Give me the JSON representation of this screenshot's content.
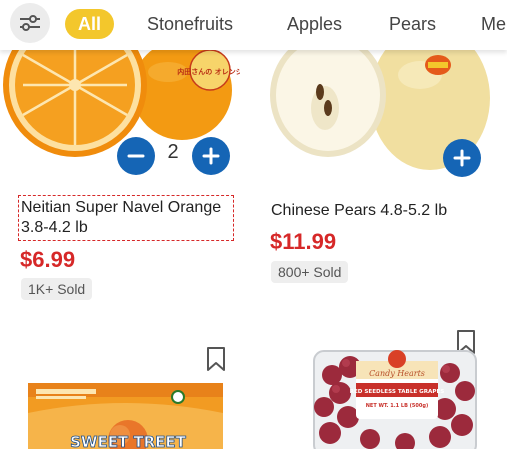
{
  "categories": {
    "items": [
      {
        "label": "All",
        "active": true
      },
      {
        "label": "Stonefruits",
        "active": false
      },
      {
        "label": "Apples",
        "active": false
      },
      {
        "label": "Pears",
        "active": false
      },
      {
        "label": "Me",
        "active": false
      }
    ]
  },
  "products": [
    {
      "name": "Neitian Super Navel Orange 3.8-4.2 lb",
      "price": "$6.99",
      "sold": "1K+ Sold",
      "quantity": "2",
      "image_label": "内田さんの オレンジ"
    },
    {
      "name": "Chinese Pears 4.8-5.2 lb",
      "price": "$11.99",
      "sold": "800+ Sold"
    },
    {
      "image_label": "SWEET TREET"
    },
    {
      "image_label_top": "Candy Hearts",
      "image_label_mid": "RED SEEDLESS TABLE GRAPES",
      "image_label_net": "NET WT. 1.1 LB (500g)"
    }
  ],
  "colors": {
    "accent_yellow": "#f3c72c",
    "action_blue": "#1565b5",
    "price_red": "#d62828",
    "badge_bg": "#eeeeee"
  },
  "icons": {
    "filter": "sliders-icon",
    "minus": "minus-icon",
    "plus": "plus-icon",
    "bookmark": "bookmark-icon"
  }
}
